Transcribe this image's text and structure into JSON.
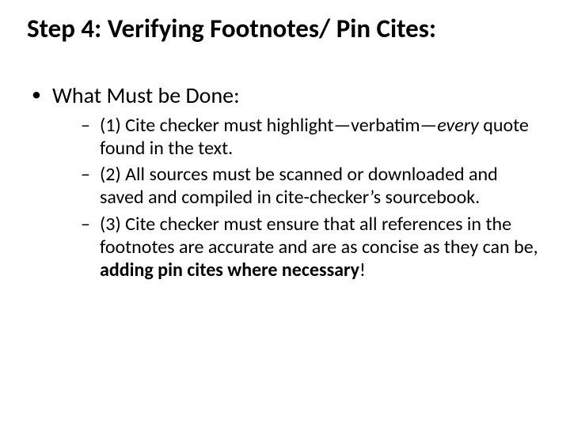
{
  "title": "Step 4: Verifying Footnotes/ Pin Cites:",
  "bullet1": "What Must be Done:",
  "item1_a": "(1) Cite checker must highlight—verbatim—",
  "item1_b": "every",
  "item1_c": " quote found in the text.",
  "item2": "(2) All sources must be scanned or downloaded and saved and compiled in cite-checker’s sourcebook.",
  "item3_a": "(3) Cite checker must ensure that all references in the footnotes are accurate and are as concise as they can be, ",
  "item3_b": "adding pin cites where necessary",
  "item3_c": "!"
}
